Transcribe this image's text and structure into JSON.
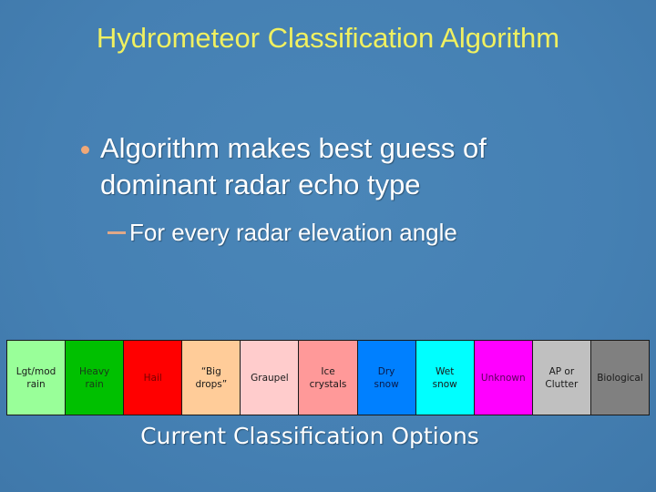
{
  "slide": {
    "title": "Hydrometeor Classification Algorithm",
    "bullets": [
      {
        "level": 1,
        "text": "Algorithm makes best guess of dominant radar echo type"
      },
      {
        "level": 2,
        "text": "For every radar elevation angle"
      }
    ],
    "caption": "Current Classification Options",
    "colors": {
      "background": "#4682b4",
      "title": "#f0f060",
      "bullet_marker": "#f0a878",
      "body_text": "#ffffff"
    }
  },
  "classifications": [
    {
      "label": "Lgt/mod\nrain",
      "color": "#99ff99",
      "text_color": "#1a1a1a"
    },
    {
      "label": "Heavy\nrain",
      "color": "#00c000",
      "text_color": "#1a3a1a"
    },
    {
      "label": "Hail",
      "color": "#ff0000",
      "text_color": "#7a0000"
    },
    {
      "label": "“Big\ndrops”",
      "color": "#ffcc99",
      "text_color": "#1a1a1a"
    },
    {
      "label": "Graupel",
      "color": "#ffcccc",
      "text_color": "#1a1a1a"
    },
    {
      "label": "Ice\ncrystals",
      "color": "#ff9999",
      "text_color": "#1a1a1a"
    },
    {
      "label": "Dry\nsnow",
      "color": "#0080ff",
      "text_color": "#0a1a4a"
    },
    {
      "label": "Wet\nsnow",
      "color": "#00ffff",
      "text_color": "#1a1a1a"
    },
    {
      "label": "Unknown",
      "color": "#ff00ff",
      "text_color": "#5a005a"
    },
    {
      "label": "AP or\nClutter",
      "color": "#c0c0c0",
      "text_color": "#1a1a1a"
    },
    {
      "label": "Biological",
      "color": "#808080",
      "text_color": "#1a1a1a"
    }
  ]
}
